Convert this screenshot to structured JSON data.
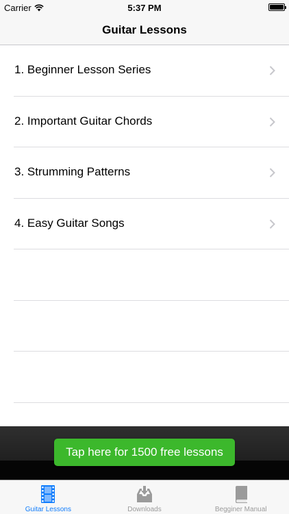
{
  "status_bar": {
    "carrier": "Carrier",
    "time": "5:37 PM"
  },
  "nav": {
    "title": "Guitar Lessons"
  },
  "lessons": [
    {
      "label": "1. Beginner Lesson Series"
    },
    {
      "label": "2. Important Guitar Chords"
    },
    {
      "label": "3. Strumming Patterns"
    },
    {
      "label": "4. Easy Guitar Songs"
    }
  ],
  "banner": {
    "cta_label": "Tap here for 1500 free lessons"
  },
  "tabs": [
    {
      "label": "Guitar Lessons",
      "icon": "film-strip-icon",
      "active": true
    },
    {
      "label": "Downloads",
      "icon": "download-tray-icon",
      "active": false
    },
    {
      "label": "Begginer Manual",
      "icon": "book-icon",
      "active": false
    }
  ],
  "colors": {
    "accent": "#0f7cfc",
    "cta": "#3cb82c",
    "inactive_tab": "#9b9b9b"
  }
}
